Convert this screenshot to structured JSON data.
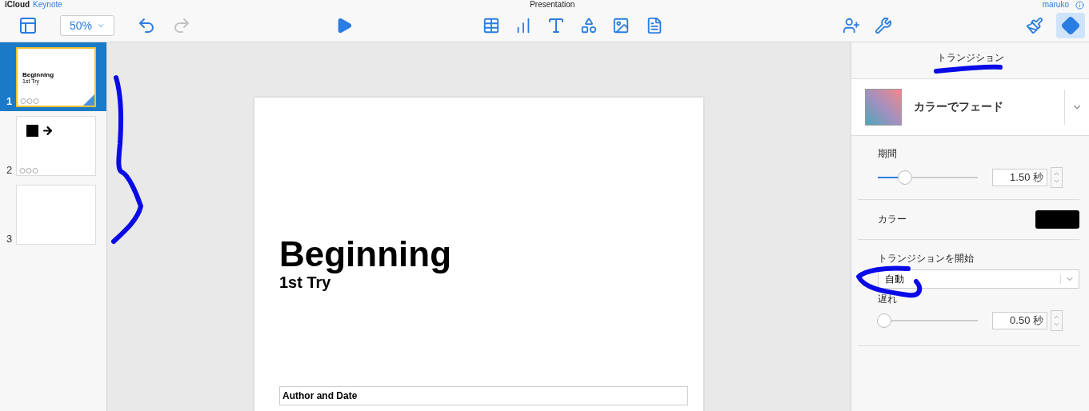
{
  "app": {
    "brand": "iCloud",
    "product": "Keynote",
    "document_title": "Presentation",
    "user": "maruko"
  },
  "toolbar": {
    "zoom": "50%",
    "redo_disabled": true,
    "inspector_buttons": [
      {
        "kind": "format",
        "selected": false
      },
      {
        "kind": "animate",
        "selected": true
      }
    ]
  },
  "slides": [
    {
      "number": "1",
      "selected": true,
      "kind": "title",
      "title": "Beginning",
      "subtitle": "1st Try"
    },
    {
      "number": "2",
      "selected": false,
      "kind": "shapes"
    },
    {
      "number": "3",
      "selected": false,
      "kind": "blank"
    }
  ],
  "slide": {
    "title": "Beginning",
    "subtitle": "1st Try",
    "footer": "Author and Date"
  },
  "inspector": {
    "tab": "トランジション",
    "effect": "カラーでフェード",
    "duration": {
      "label": "期間",
      "level": 0.27,
      "value": "1.50 秒"
    },
    "color": {
      "label": "カラー"
    },
    "start": {
      "label": "トランジションを開始",
      "value": "自動"
    },
    "delay": {
      "label": "遅れ",
      "level": 0.06,
      "value": "0.50 秒"
    }
  }
}
